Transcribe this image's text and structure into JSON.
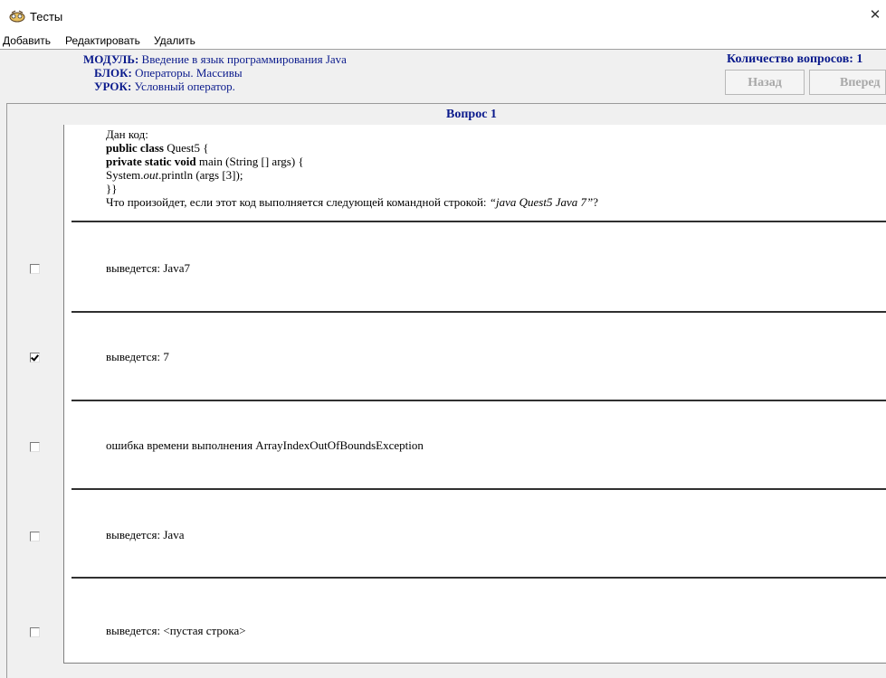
{
  "window": {
    "title": "Тесты",
    "close": "✕"
  },
  "menu": {
    "add": "Добавить",
    "edit": "Редактировать",
    "delete": "Удалить"
  },
  "header": {
    "module_label": "МОДУЛЬ:",
    "module_value": "Введение в язык программирования Java",
    "block_label": "БЛОК:",
    "block_value": "Операторы. Массивы",
    "lesson_label": "УРОК:",
    "lesson_value": "Условный оператор.",
    "count": "Количество вопросов: 1",
    "back": "Назад",
    "forward": "Вперед"
  },
  "question": {
    "title": "Вопрос 1",
    "intro": "Дан код:",
    "code1_kw": "public class",
    "code1_rest": " Quest5 {",
    "code2_kw": "private static void",
    "code2_rest": " main (String [] args) {",
    "code3_a": "System.",
    "code3_b": "out",
    "code3_c": ".println (args [3]);",
    "code4": "}}",
    "prompt_text": "Что произойдет, если этот код выполняется следующей командной строкой: ",
    "prompt_cmd": "“java Quest5 Java  7”",
    "prompt_end": "?"
  },
  "answers": [
    {
      "text": "выведется: Java7",
      "checked": false
    },
    {
      "text": "выведется: 7",
      "checked": true
    },
    {
      "text": "ошибка времени выполнения ArrayIndexOutOfBoundsException",
      "checked": false
    },
    {
      "text": "выведется: Java",
      "checked": false
    },
    {
      "text": "выведется: <пустая строка>",
      "checked": false
    }
  ]
}
